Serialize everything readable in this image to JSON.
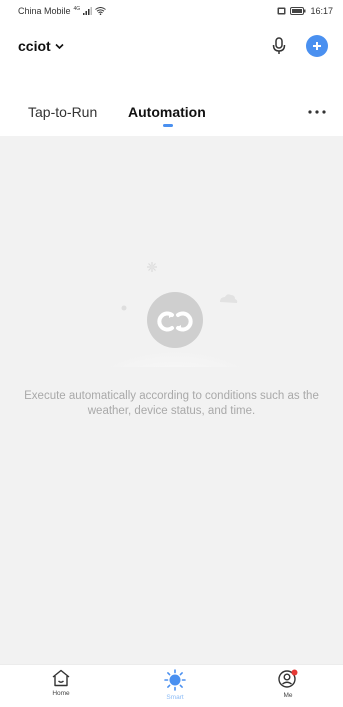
{
  "status_bar": {
    "carrier": "China Mobile",
    "network": "4G",
    "time": "16:17"
  },
  "header": {
    "home_name": "cciot"
  },
  "tabs": [
    {
      "label": "Tap-to-Run",
      "active": false
    },
    {
      "label": "Automation",
      "active": true
    }
  ],
  "empty_state": {
    "message": "Execute automatically according to conditions such as the weather, device status, and time."
  },
  "bottom_nav": [
    {
      "label": "Home",
      "icon": "home-icon",
      "active": false
    },
    {
      "label": "Smart",
      "icon": "smart-sun-icon",
      "active": true
    },
    {
      "label": "Me",
      "icon": "me-icon",
      "active": false,
      "has_badge": true
    }
  ],
  "colors": {
    "accent": "#4a90f0",
    "accent_light": "#8cbcf6",
    "badge": "#e53935",
    "empty_text": "#a9a9a9",
    "content_bg": "#f2f2f2"
  }
}
